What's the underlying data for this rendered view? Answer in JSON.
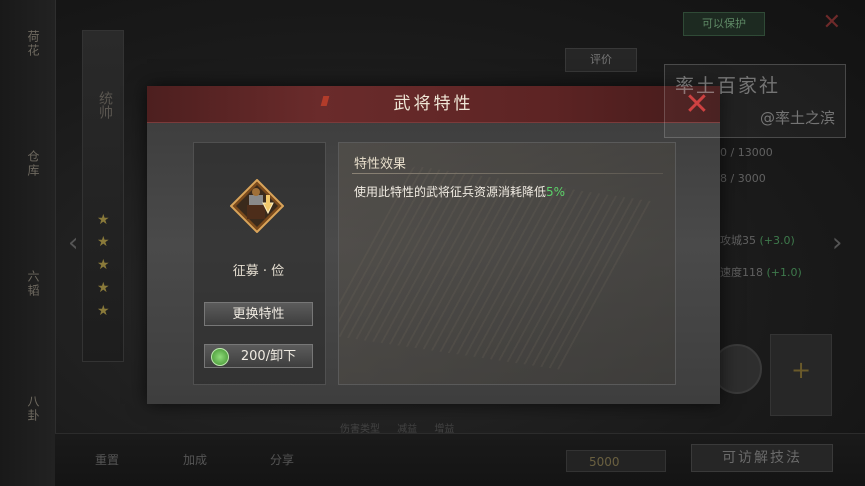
{
  "background": {
    "left_rail": [
      "荷花",
      "仓库",
      "六韬",
      "八卦"
    ],
    "rank_label": "统帅",
    "stars": 5,
    "top_button": "可以保护",
    "right_tab": "评价",
    "stats": [
      {
        "text": "0 / 13000",
        "green": ""
      },
      {
        "text": "8 / 3000",
        "green": ""
      },
      {
        "text": "攻城35",
        "green": "(+3.0)"
      },
      {
        "text": "速度118",
        "green": "(+1.0)"
      }
    ],
    "bottom_items": [
      "重置",
      "加成",
      "分享"
    ],
    "coin_value": "5000",
    "wide_button": "可访解技法",
    "legend": [
      "伤害类型",
      "减益",
      "增益"
    ]
  },
  "watermark": {
    "line1": "率土百家社",
    "line2": "@率土之滨"
  },
  "modal": {
    "title": "武将特性",
    "close_icon": "close-x",
    "trait": {
      "name": "征募 · 俭",
      "icon": "soldier-down-arrow-icon"
    },
    "buttons": {
      "change": "更换特性",
      "unload": "200/卸下"
    },
    "effect": {
      "title": "特性效果",
      "text_prefix": "使用此特性的武将征兵资源消耗降低",
      "text_value": "5%"
    }
  },
  "colors": {
    "header_red": "#6a2b2b",
    "close_red": "#cc3a3a",
    "highlight_green": "#5bd46a"
  }
}
